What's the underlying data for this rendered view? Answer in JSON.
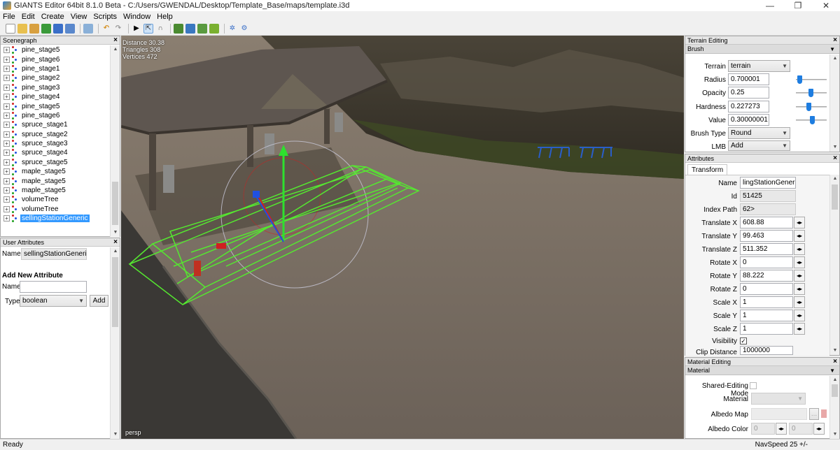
{
  "window": {
    "title": "GIANTS Editor 64bit 8.1.0 Beta - C:/Users/GWENDAL/Desktop/Template_Base/maps/template.i3d",
    "minimize": "—",
    "restore": "❐",
    "close": "✕"
  },
  "menu": [
    "File",
    "Edit",
    "Create",
    "View",
    "Scripts",
    "Window",
    "Help"
  ],
  "scenegraph": {
    "title": "Scenegraph",
    "items": [
      {
        "label": "pine_stage5"
      },
      {
        "label": "pine_stage6"
      },
      {
        "label": "pine_stage1"
      },
      {
        "label": "pine_stage2"
      },
      {
        "label": "pine_stage3"
      },
      {
        "label": "pine_stage4"
      },
      {
        "label": "pine_stage5"
      },
      {
        "label": "pine_stage6"
      },
      {
        "label": "spruce_stage1"
      },
      {
        "label": "spruce_stage2"
      },
      {
        "label": "spruce_stage3"
      },
      {
        "label": "spruce_stage4"
      },
      {
        "label": "spruce_stage5"
      },
      {
        "label": "maple_stage5"
      },
      {
        "label": "maple_stage5"
      },
      {
        "label": "maple_stage5"
      },
      {
        "label": "volumeTree"
      },
      {
        "label": "volumeTree"
      },
      {
        "label": "sellingStationGeneric",
        "selected": true
      }
    ]
  },
  "user_attributes": {
    "title": "User Attributes",
    "name_label": "Name",
    "name_value": "sellingStationGeneric",
    "add_heading": "Add New Attribute",
    "new_name_label": "Name",
    "new_name_value": "",
    "type_label": "Type",
    "type_value": "boolean",
    "add_button": "Add"
  },
  "viewport": {
    "stats": [
      "Distance 30.38",
      "Triangles 308",
      "Vertices 472"
    ],
    "camera": "persp"
  },
  "terrain_editing": {
    "title": "Terrain Editing",
    "section": "Brush",
    "terrain_label": "Terrain",
    "terrain_value": "terrain",
    "radius_label": "Radius",
    "radius_value": "0.700001",
    "opacity_label": "Opacity",
    "opacity_value": "0.25",
    "hardness_label": "Hardness",
    "hardness_value": "0.227273",
    "value_label": "Value",
    "value_value": "0.30000001",
    "brush_type_label": "Brush Type",
    "brush_type_value": "Round",
    "lmb_label": "LMB",
    "lmb_value": "Add",
    "slider_levels": {
      "radius": 0.1,
      "opacity": 0.4,
      "hardness": 0.35,
      "value": 0.45
    }
  },
  "attributes": {
    "title": "Attributes",
    "tab": "Transform",
    "fields": {
      "name": {
        "label": "Name",
        "value": "lingStationGeneric"
      },
      "id": {
        "label": "Id",
        "value": "51425"
      },
      "index_path": {
        "label": "Index Path",
        "value": "62>"
      },
      "translate_x": {
        "label": "Translate X",
        "value": "608.88"
      },
      "translate_y": {
        "label": "Translate Y",
        "value": "99.463"
      },
      "translate_z": {
        "label": "Translate Z",
        "value": "511.352"
      },
      "rotate_x": {
        "label": "Rotate X",
        "value": "0"
      },
      "rotate_y": {
        "label": "Rotate Y",
        "value": "88.222"
      },
      "rotate_z": {
        "label": "Rotate Z",
        "value": "0"
      },
      "scale_x": {
        "label": "Scale X",
        "value": "1"
      },
      "scale_y": {
        "label": "Scale Y",
        "value": "1"
      },
      "scale_z": {
        "label": "Scale Z",
        "value": "1"
      },
      "visibility": {
        "label": "Visibility",
        "checked": true
      },
      "clip_distance": {
        "label": "Clip Distance",
        "value": "1000000"
      }
    },
    "spin_glyph": "◂▸"
  },
  "material_editing": {
    "title": "Material Editing",
    "section": "Material",
    "shared_mode_label": "Shared-Editing Mode",
    "material_label": "Material",
    "albedo_map_label": "Albedo Map",
    "albedo_map_button": "...",
    "albedo_color_label": "Albedo Color",
    "albedo_color_r": "0",
    "albedo_color_g": "0"
  },
  "status": {
    "left": "Ready",
    "right": "NavSpeed 25 +/-"
  }
}
